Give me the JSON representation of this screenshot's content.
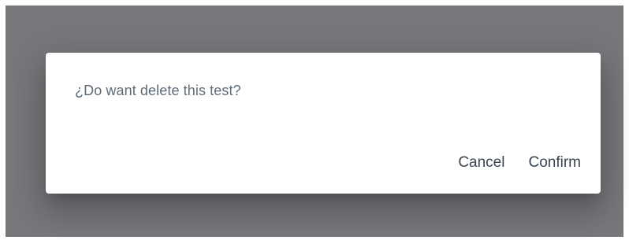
{
  "dialog": {
    "message": "¿Do want delete this test?",
    "actions": {
      "cancel_label": "Cancel",
      "confirm_label": "Confirm"
    }
  }
}
